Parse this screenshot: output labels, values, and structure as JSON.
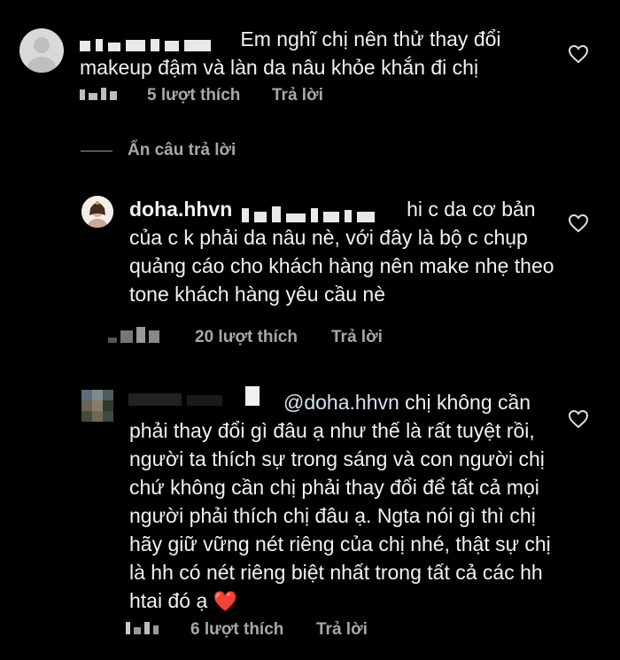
{
  "comments": [
    {
      "username_blurred": true,
      "text": "Em nghĩ chị nên thử thay đổi makeup đậm và làn da nâu khỏe khắn đi chị",
      "likes": "5 lượt thích",
      "reply": "Trả lời"
    },
    {
      "username": "doha.hhvn",
      "text": "hi c da cơ bản của c k phải da nâu  nè, với đây là bộ c chụp quảng cáo cho khách hàng nên make nhẹ theo tone khách hàng yêu cầu nè",
      "likes": "20 lượt thích",
      "reply": "Trả lời"
    },
    {
      "username_blurred": true,
      "mention": "@doha.hhvn",
      "text": "chị không cần phải thay đổi gì đâu ạ như thế là rất tuyệt rồi, người ta thích sự trong sáng và con người chị chứ không cần chị phải thay đổi để tất cả mọi người phải thích chị đâu ạ. Ngta nói gì thì chị hãy giữ vững nét riêng của chị nhé, thật sự chị là hh có nét riêng biệt nhất trong tất cả các hh htai đó ạ",
      "emoji": "❤️",
      "likes": "6 lượt thích",
      "reply": "Trả lời"
    }
  ],
  "hide_replies": "Ẩn câu trả lời",
  "colors": {
    "background": "#000000",
    "text": "#f2f2f2",
    "meta": "#a8a8a8",
    "heart_emoji": "#e8141e"
  }
}
